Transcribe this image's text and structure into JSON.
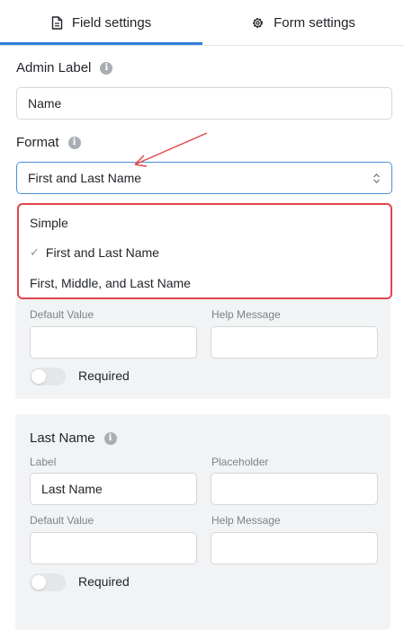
{
  "tabs": {
    "field_settings": "Field settings",
    "form_settings": "Form settings"
  },
  "admin_label": {
    "label": "Admin Label",
    "value": "Name"
  },
  "format": {
    "label": "Format",
    "selected": "First and Last Name",
    "options": [
      "Simple",
      "First and Last Name",
      "First, Middle, and Last Name"
    ],
    "checked_index": 1
  },
  "first_name_card": {
    "default_value_label": "Default Value",
    "help_message_label": "Help Message",
    "default_value": "",
    "help_message": "",
    "required_label": "Required",
    "required": false
  },
  "last_name_card": {
    "title": "Last Name",
    "label_label": "Label",
    "placeholder_label": "Placeholder",
    "label_value": "Last Name",
    "placeholder_value": "",
    "default_value_label": "Default Value",
    "help_message_label": "Help Message",
    "default_value": "",
    "help_message": "",
    "required_label": "Required",
    "required": false
  },
  "colors": {
    "accent": "#2f7fd8",
    "highlight": "#e0454b"
  }
}
